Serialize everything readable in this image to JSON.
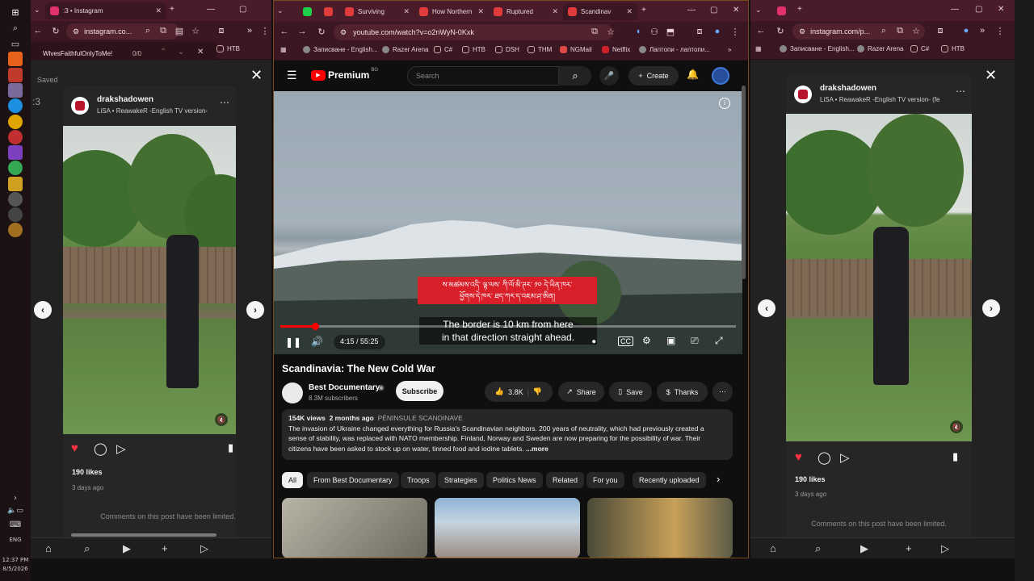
{
  "taskbar": {
    "time": "12:37 PM",
    "date": "8/5/2026",
    "lang": "ENG"
  },
  "left_window": {
    "tab_title": ":3 • Instagram",
    "url": "instagram.co...",
    "find_text": "WlvesFaithfulOnlyToMe!",
    "find_count": "0/0",
    "bookmark": "НТВ",
    "saved_label": "Saved",
    "num_text": ":3",
    "post": {
      "username": "drakshadowen",
      "audio": "LiSA • ReawakeR -English TV version-",
      "likes": "190 likes",
      "ago": "3 days ago",
      "comments_limited": "Comments on this post have been limited."
    }
  },
  "mid_window": {
    "tabs": [
      {
        "title": "Surviving",
        "color": "#e23b3b"
      },
      {
        "title": "How Northern",
        "color": "#e23b3b"
      },
      {
        "title": "Ruptured",
        "color": "#e23b3b"
      },
      {
        "title": "Scandinav",
        "color": "#e23b3b"
      }
    ],
    "url": "youtube.com/watch?v=o2nWyN-0Kxk",
    "bookmarks": [
      "Записване - English...",
      "Razer Arena",
      "C#",
      "НТВ",
      "DSH",
      "ТНМ",
      "NGMail",
      "Netflix",
      "Лаптопи - лаптопи..."
    ],
    "yt": {
      "logo": "Premium",
      "logo_sup": "BG",
      "search_placeholder": "Search",
      "create_label": "Create",
      "subtitle_foreign_1": "ས་མཚམས་འདི་ ལྟ་ལས་ ཀི་ལོ་མི་ཊར་ ༡༠ དེ་ཡིན་ཁར་",
      "subtitle_foreign_2": "ཕྱོགས་དེ་ཁར་ ཐད་ཀར་ད་འཇམ་ཤ་ཨིན།",
      "subtitle_en_1": "The border is 10 km from here",
      "subtitle_en_2": "in that direction straight ahead.",
      "time": "4:15 / 55:25",
      "progress": 0.077,
      "video_title": "Scandinavia: The New Cold War",
      "channel": "Best Documentary",
      "subscribers": "8.3M subscribers",
      "subscribe_label": "Subscribe",
      "like_count": "3.8K",
      "share_label": "Share",
      "save_label": "Save",
      "thanks_label": "Thanks",
      "views": "154K views",
      "posted": "2 months ago",
      "tag": "PÉNINSULE SCANDINAVE",
      "desc_1": "The invasion of Ukraine changed everything for Russia's Scandinavian neighbors. 200 years of neutrality, which had previously created a",
      "desc_2": "sense of stability, was replaced with NATO membership. Finland, Norway and Sweden are now preparing for the possibility of war. Their",
      "desc_3": "citizens have been asked to stock up on water, tinned food and iodine tablets.",
      "more_label": "...more",
      "chips": [
        "All",
        "From Best Documentary",
        "Troops",
        "Strategies",
        "Politics News",
        "Related",
        "For you",
        "Recently uploaded"
      ]
    }
  },
  "right_window": {
    "url": "instagram.com/p...",
    "bookmarks": [
      "Записване - English...",
      "Razer Arena",
      "C#",
      "НТВ"
    ],
    "post": {
      "username": "drakshadowen",
      "audio": "LiSA • ReawakeR -English TV version- (fe",
      "likes": "190 likes",
      "ago": "3 days ago",
      "comments_limited": "Comments on this post have been limited."
    }
  }
}
